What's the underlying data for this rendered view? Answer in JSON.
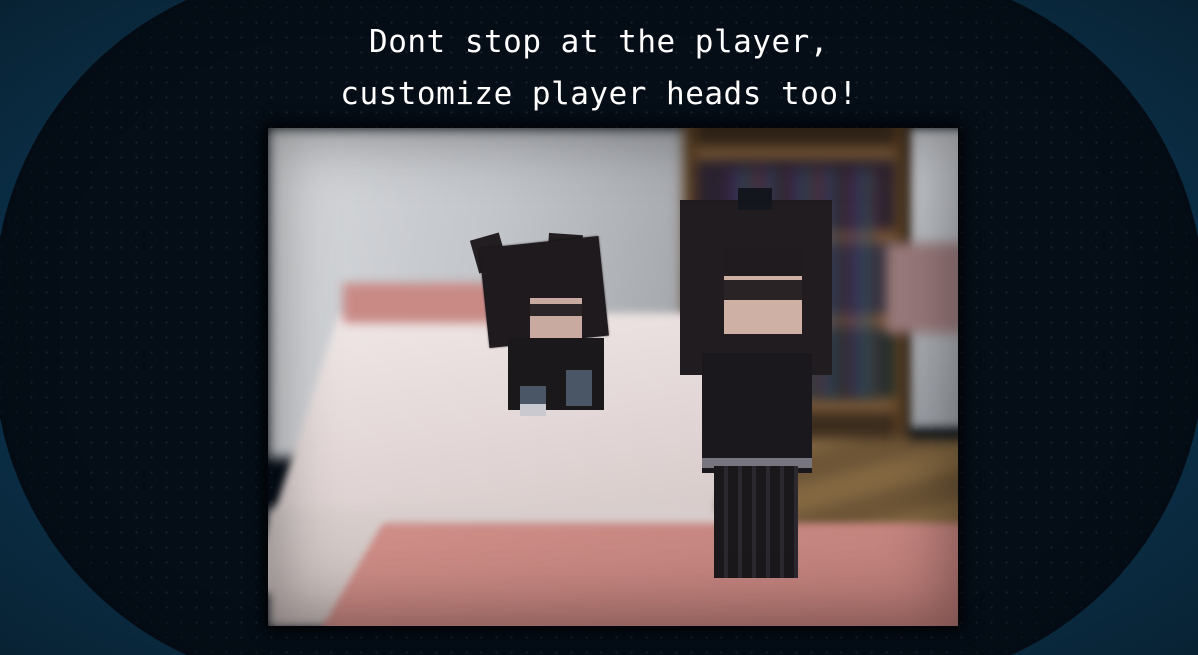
{
  "headline": {
    "line1": "Dont stop at the player,",
    "line2": "customize player heads too!"
  },
  "screenshot": {
    "subject": "minecraft-scene",
    "colors": {
      "frame_bg": "#050d16",
      "outer_bg": "#0e3047",
      "text": "#ffffff"
    }
  }
}
